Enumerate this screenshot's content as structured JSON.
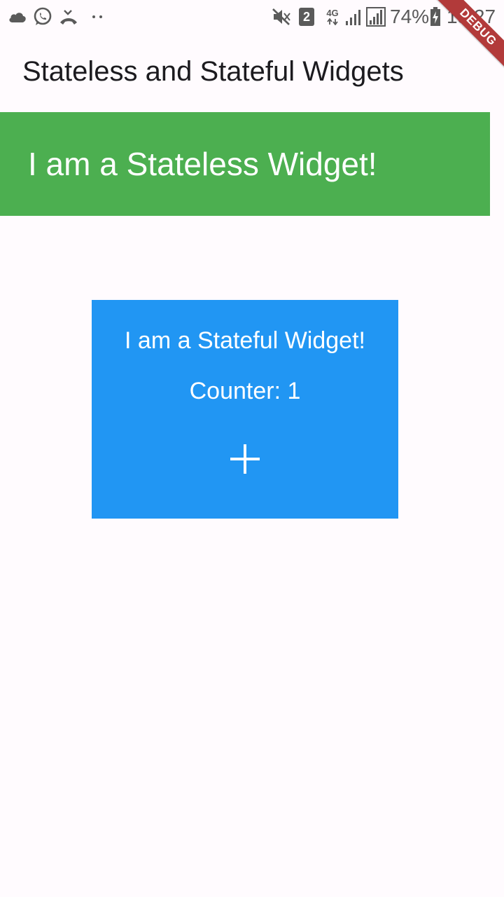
{
  "status_bar": {
    "battery_percent": "74%",
    "time": "13:27",
    "sim_badge": "2",
    "network_type": "4G",
    "icons": [
      "cloud-icon",
      "whatsapp-icon",
      "missed-call-icon",
      "more-dots-icon",
      "mute-icon",
      "sim-2-icon",
      "network-4g-icon",
      "signal-icon",
      "signal-icon",
      "battery-charging-icon"
    ]
  },
  "debug_banner": {
    "label": "DEBUG",
    "color": "#b23a3a"
  },
  "app_bar": {
    "title": "Stateless and Stateful Widgets"
  },
  "stateless_widget": {
    "text": "I am a Stateless Widget!",
    "background": "#4caf50"
  },
  "stateful_widget": {
    "text": "I am a Stateful Widget!",
    "counter_label": "Counter: ",
    "counter_value": "1",
    "background": "#2196f3",
    "button_icon": "add-icon"
  }
}
